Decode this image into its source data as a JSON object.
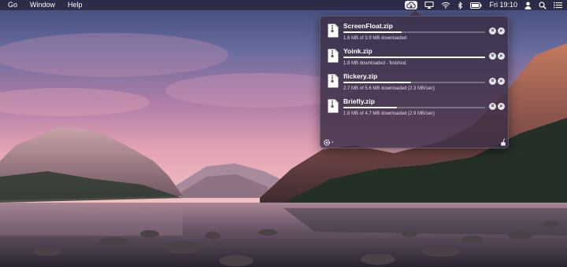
{
  "menubar": {
    "menus": [
      "Go",
      "Window",
      "Help"
    ],
    "clock": "Fri 19:10",
    "status_icons": [
      "download-cloud-icon",
      "airplay-icon",
      "wifi-icon",
      "bluetooth-icon",
      "battery-icon",
      "user-icon",
      "spotlight-search-icon",
      "notification-list-icon"
    ]
  },
  "downloads": [
    {
      "name": "ScreenFloat.zip",
      "status": "1.6 MB of 3.9 MB downloaded",
      "progress": 0.41
    },
    {
      "name": "Yoink.zip",
      "status": "1.8 MB downloaded - finished.",
      "progress": 1.0
    },
    {
      "name": "flickery.zip",
      "status": "2.7 MB of 5.6 MB downloaded (2.3 MB/sec)",
      "progress": 0.48
    },
    {
      "name": "Briefly.zip",
      "status": "1.8 MB of 4.7 MB downloaded (2.9 MB/sec)",
      "progress": 0.38
    }
  ],
  "buttons": {
    "stop": "×",
    "reveal": "⌕"
  },
  "colors": {
    "accent": "#ffffff",
    "popover": "#3c2e46"
  }
}
